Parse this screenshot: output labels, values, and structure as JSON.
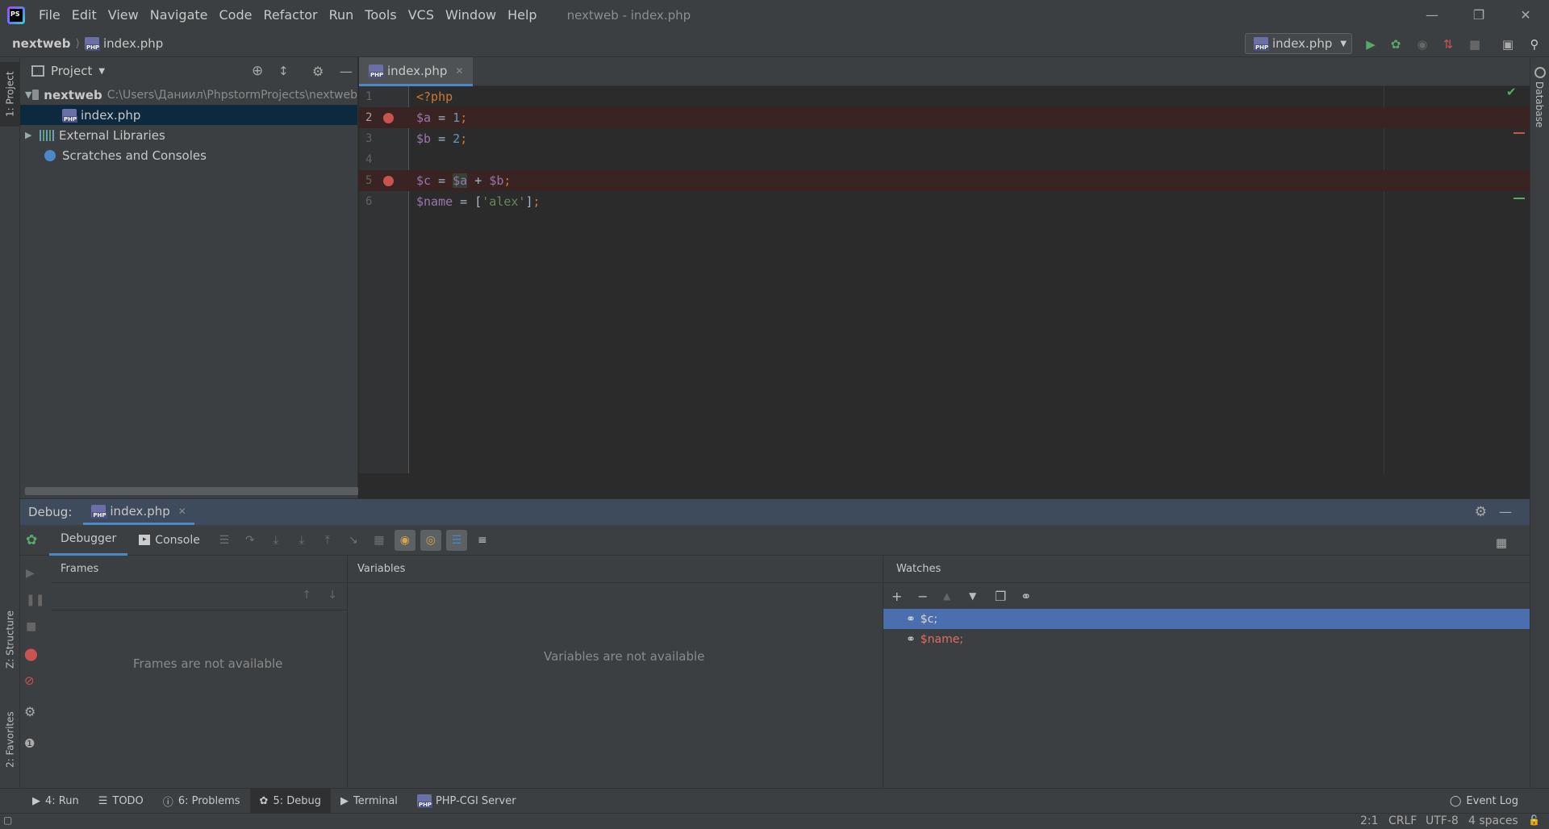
{
  "menu": [
    "File",
    "Edit",
    "View",
    "Navigate",
    "Code",
    "Refactor",
    "Run",
    "Tools",
    "VCS",
    "Window",
    "Help"
  ],
  "window_title": "nextweb - index.php",
  "breadcrumb": {
    "project": "nextweb",
    "file": "index.php"
  },
  "run_config": "index.php",
  "left_stripe": {
    "project": "1: Project",
    "structure": "Z: Structure",
    "favorites": "2: Favorites"
  },
  "right_stripe": {
    "database": "Database"
  },
  "project_panel": {
    "title": "Project",
    "root_name": "nextweb",
    "root_path": "C:\\Users\\Даниил\\PhpstormProjects\\nextweb",
    "file": "index.php",
    "external": "External Libraries",
    "scratches": "Scratches and Consoles"
  },
  "editor": {
    "tab": "index.php",
    "lines": [
      {
        "n": "1",
        "bp": false
      },
      {
        "n": "2",
        "bp": true
      },
      {
        "n": "3",
        "bp": false
      },
      {
        "n": "4",
        "bp": false
      },
      {
        "n": "5",
        "bp": true
      },
      {
        "n": "6",
        "bp": false
      }
    ]
  },
  "debug": {
    "label": "Debug:",
    "tab": "index.php",
    "subtabs": {
      "debugger": "Debugger",
      "console": "Console"
    },
    "frames_title": "Frames",
    "frames_empty": "Frames are not available",
    "variables_title": "Variables",
    "variables_empty": "Variables are not available",
    "watches_title": "Watches",
    "watches": [
      "$c;",
      "$name;"
    ]
  },
  "bottom_tools": {
    "run": "4: Run",
    "todo": "TODO",
    "problems": "6: Problems",
    "debug": "5: Debug",
    "terminal": "Terminal",
    "phpcgi": "PHP-CGI Server",
    "event_log": "Event Log"
  },
  "status": {
    "pos": "2:1",
    "eol": "CRLF",
    "enc": "UTF-8",
    "indent": "4 spaces"
  }
}
